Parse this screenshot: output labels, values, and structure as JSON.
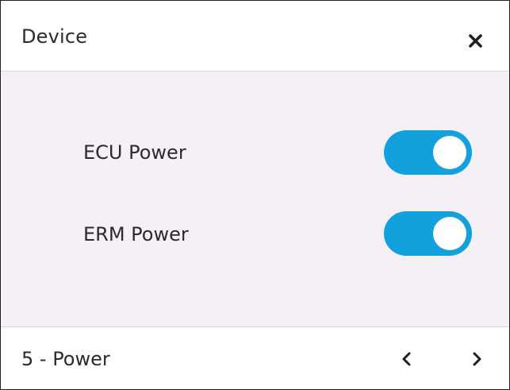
{
  "dialog": {
    "title": "Device",
    "close_icon": "close-icon"
  },
  "settings": [
    {
      "label": "ECU Power",
      "state": "on",
      "accent": "#12a1dc"
    },
    {
      "label": "ERM Power",
      "state": "on",
      "accent": "#12a1dc"
    }
  ],
  "footer": {
    "page_label": "5 - Power",
    "prev_icon": "chevron-left-icon",
    "next_icon": "chevron-right-icon"
  }
}
